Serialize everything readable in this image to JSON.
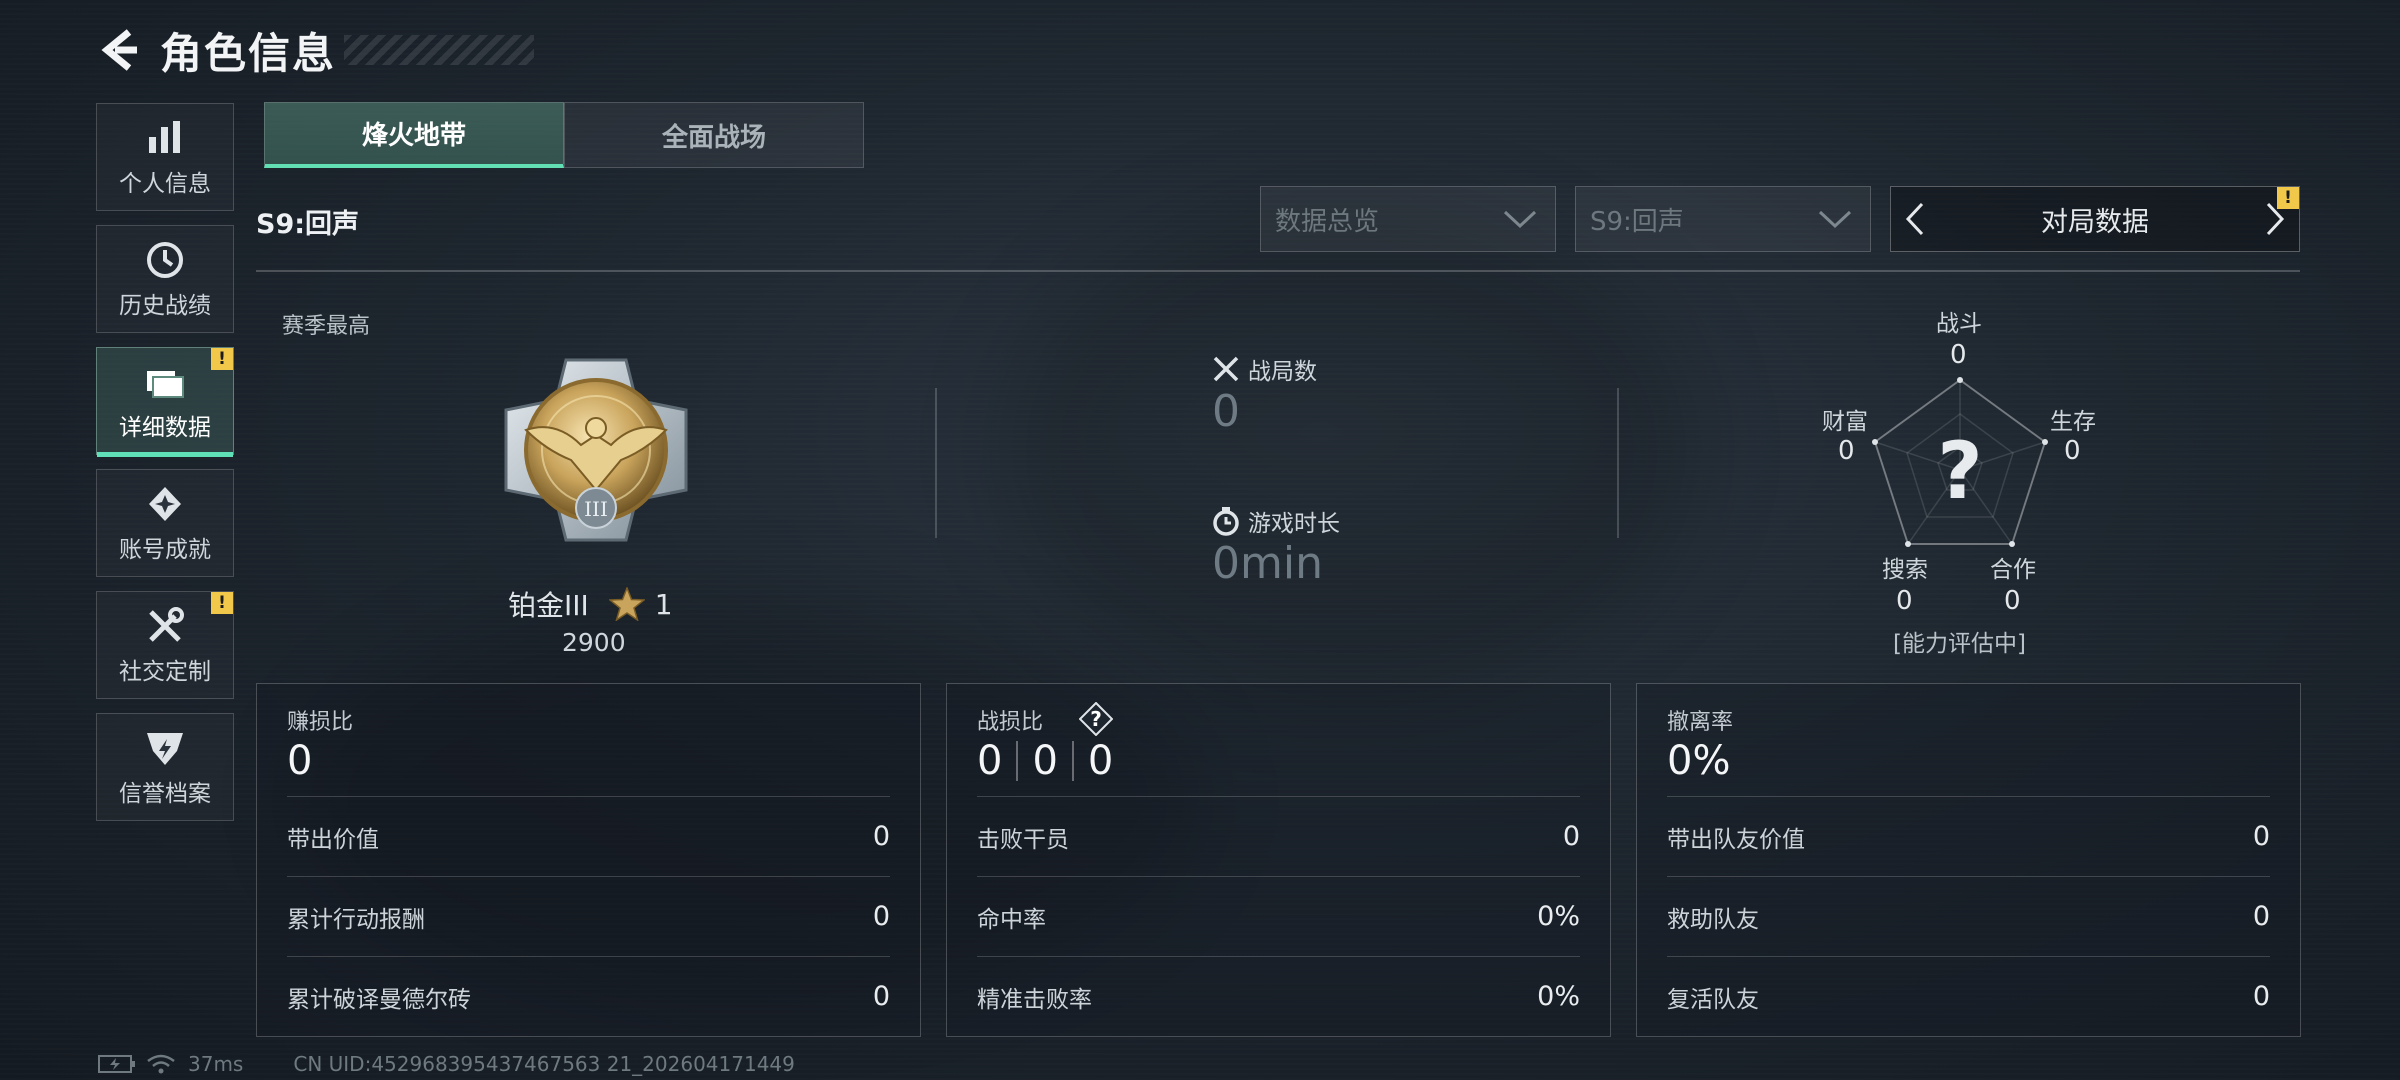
{
  "header": {
    "title": "角色信息"
  },
  "sidebar": {
    "items": [
      {
        "label": "个人信息",
        "icon": "bar-chart-icon",
        "active": false,
        "badge": ""
      },
      {
        "label": "历史战绩",
        "icon": "clock-icon",
        "active": false,
        "badge": ""
      },
      {
        "label": "详细数据",
        "icon": "folder-icon",
        "active": true,
        "badge": "!"
      },
      {
        "label": "账号成就",
        "icon": "achievement-icon",
        "active": false,
        "badge": ""
      },
      {
        "label": "社交定制",
        "icon": "tools-icon",
        "active": false,
        "badge": "!"
      },
      {
        "label": "信誉档案",
        "icon": "shield-emblem-icon",
        "active": false,
        "badge": ""
      }
    ]
  },
  "mode_tabs": [
    {
      "label": "烽火地带",
      "active": true
    },
    {
      "label": "全面战场",
      "active": false
    }
  ],
  "season_label": "S9:回声",
  "filters": {
    "overview": "数据总览",
    "season": "S9:回声",
    "switcher": "对局数据",
    "switcher_badge": "!"
  },
  "rank": {
    "caption": "赛季最高",
    "name": "铂金III",
    "stars": "1",
    "points": "2900",
    "medal_numeral": "III"
  },
  "stats": {
    "matches_label": "战局数",
    "matches_value": "0",
    "playtime_label": "游戏时长",
    "playtime_value": "0min"
  },
  "radar": {
    "axes": [
      {
        "label": "战斗",
        "value": "0"
      },
      {
        "label": "生存",
        "value": "0"
      },
      {
        "label": "合作",
        "value": "0"
      },
      {
        "label": "搜索",
        "value": "0"
      },
      {
        "label": "财富",
        "value": "0"
      }
    ],
    "center_symbol": "?",
    "status": "[能力评估中]"
  },
  "panels": [
    {
      "title": "赚损比",
      "big_value": "0",
      "rows": [
        {
          "label": "带出价值",
          "value": "0"
        },
        {
          "label": "累计行动报酬",
          "value": "0"
        },
        {
          "label": "累计破译曼德尔砖",
          "value": "0"
        }
      ]
    },
    {
      "title": "战损比",
      "help": "?",
      "kd_values": [
        "0",
        "0",
        "0"
      ],
      "rows": [
        {
          "label": "击败干员",
          "value": "0"
        },
        {
          "label": "命中率",
          "value": "0%"
        },
        {
          "label": "精准击败率",
          "value": "0%"
        }
      ]
    },
    {
      "title": "撤离率",
      "big_value": "0%",
      "rows": [
        {
          "label": "带出队友价值",
          "value": "0"
        },
        {
          "label": "救助队友",
          "value": "0"
        },
        {
          "label": "复活队友",
          "value": "0"
        }
      ]
    }
  ],
  "footer": {
    "ping": "37ms",
    "uid": "CN UID:452968395437467563 21_202604171449"
  },
  "colors": {
    "accent": "#5fe0b6",
    "badge": "#f2c84a",
    "gold": "#c9a45c"
  }
}
